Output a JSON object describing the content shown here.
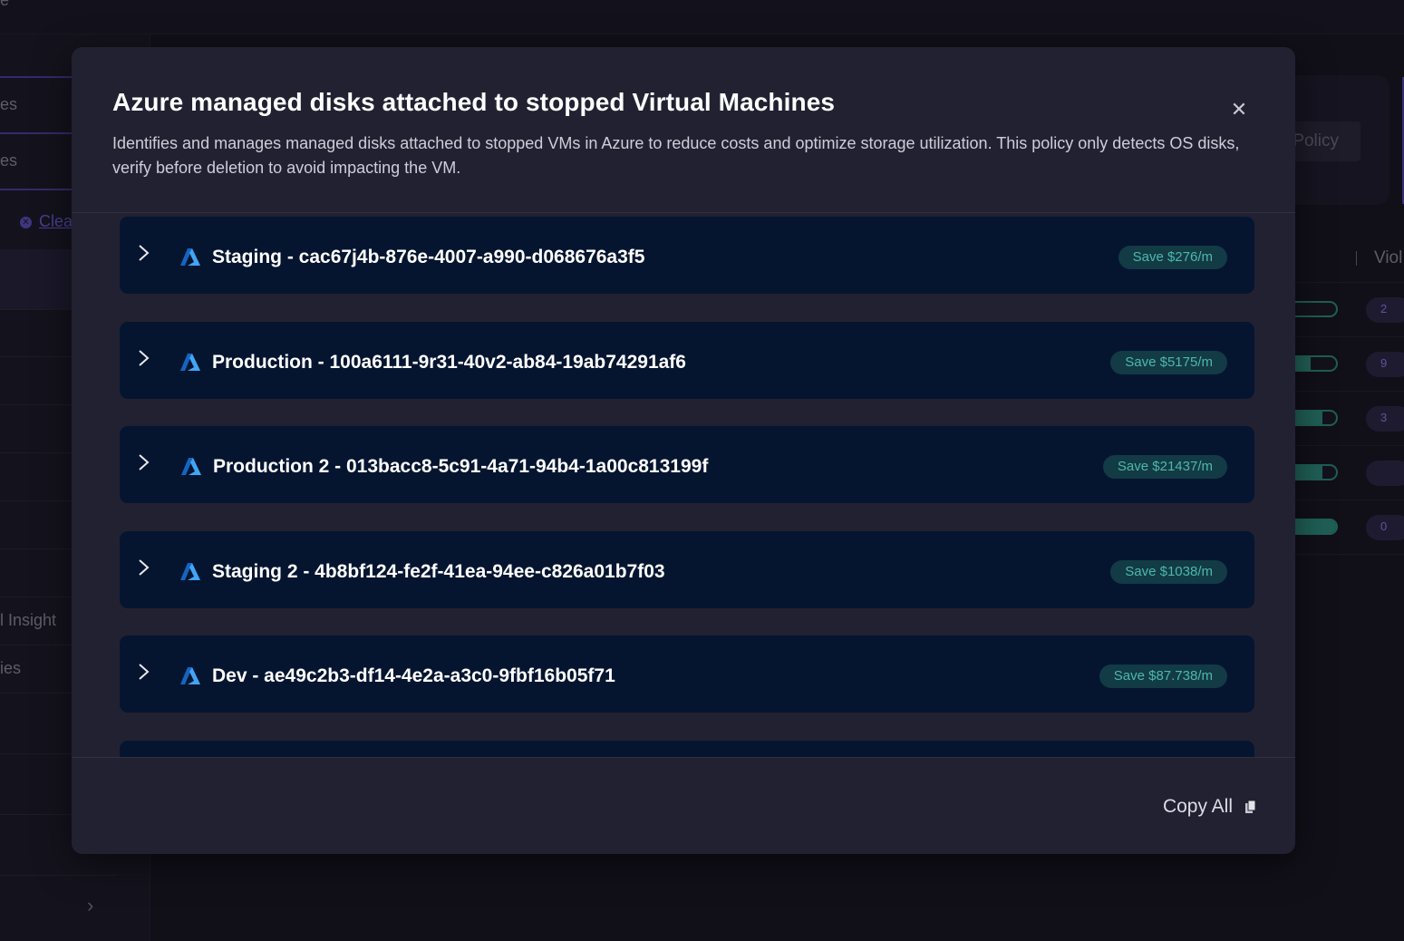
{
  "background": {
    "topbar_stub": "e",
    "sidebar_items": [
      "es",
      "es"
    ],
    "clear_label": "Clea",
    "lower_items": [
      "l Insight",
      "ies"
    ],
    "policy_button": "Policy",
    "column_header": "Viol",
    "row_pill_digits": [
      "2",
      "9",
      "3",
      "",
      "0"
    ],
    "row_bar_fill": [
      0.0,
      0.55,
      0.75,
      0.75,
      1.0
    ]
  },
  "modal": {
    "title": "Azure managed disks attached to stopped Virtual Machines",
    "description": "Identifies and manages managed disks attached to stopped VMs in Azure to reduce costs and optimize storage utilization. This policy only detects OS disks, verify before deletion to avoid impacting the VM.",
    "items": [
      {
        "label": "Staging - cac67j4b-876e-4007-a990-d068676a3f5",
        "save": "Save $276/m"
      },
      {
        "label": "Production - 100a6111-9r31-40v2-ab84-19ab74291af6",
        "save": "Save $5175/m"
      },
      {
        "label": "Production 2 - 013bacc8-5c91-4a71-94b4-1a00c813199f",
        "save": "Save $21437/m"
      },
      {
        "label": "Staging 2 - 4b8bf124-fe2f-41ea-94ee-c826a01b7f03",
        "save": "Save $1038/m"
      },
      {
        "label": "Dev - ae49c2b3-df14-4e2a-a3c0-9fbf16b05f71",
        "save": "Save $87.738/m"
      }
    ],
    "copy_all_label": "Copy All",
    "colors": {
      "card": "#051530",
      "save_bg": "#123b45",
      "save_text": "#4eb8aa",
      "azure_blue": "#1e88e5"
    }
  }
}
